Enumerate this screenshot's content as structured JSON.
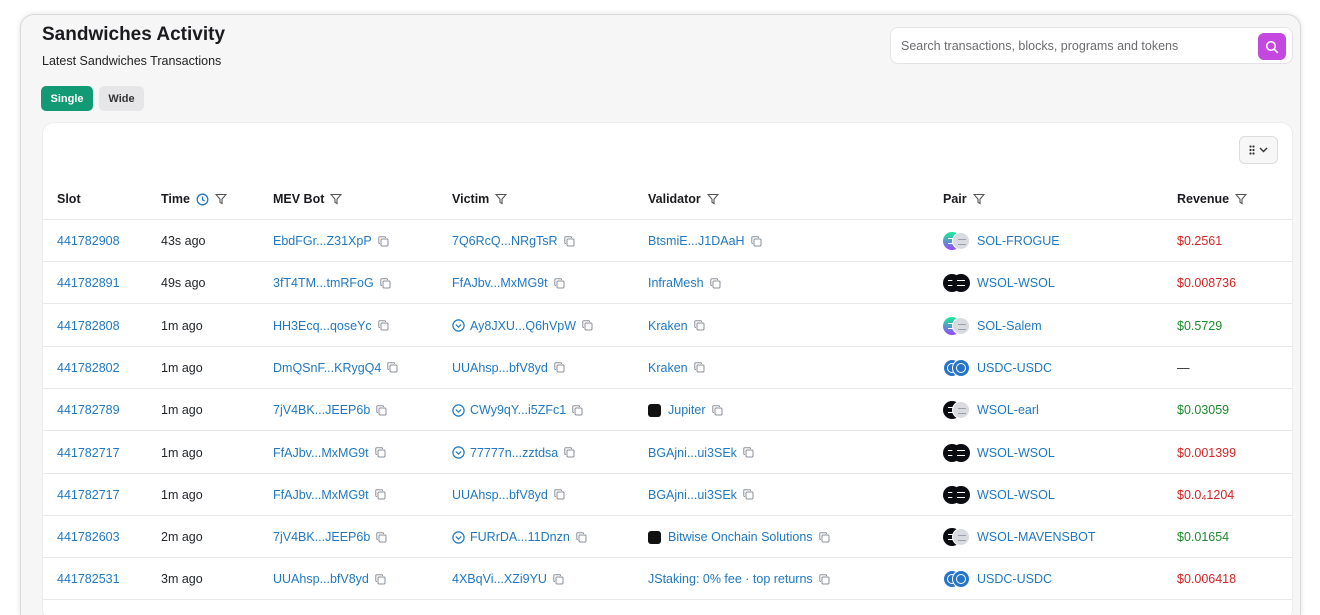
{
  "header": {
    "title": "Sandwiches Activity",
    "subtitle": "Latest Sandwiches Transactions"
  },
  "search": {
    "placeholder": "Search transactions, blocks, programs and tokens",
    "value": ""
  },
  "modes": {
    "single_label": "Single",
    "wide_label": "Wide",
    "selected": "Single"
  },
  "colors": {
    "accent_green": "#119a74",
    "search_button": "#c447e0",
    "link": "#1f78c1",
    "revenue_negative": "#d32525",
    "revenue_positive": "#1c8a2c"
  },
  "table": {
    "columns": {
      "slot": "Slot",
      "time": "Time",
      "mev_bot": "MEV Bot",
      "victim": "Victim",
      "validator": "Validator",
      "pair": "Pair",
      "revenue": "Revenue"
    },
    "rows": [
      {
        "slot": "441782908",
        "time": "43s ago",
        "mev_bot": "EbdFGr...Z31XpP",
        "victim": "7Q6RcQ...NRgTsR",
        "victim_verified": false,
        "validator": "BtsmiE...J1DAaH",
        "validator_logo": false,
        "pair": "SOL-FROGUE",
        "pair_tokens": [
          "sol",
          "grey"
        ],
        "revenue": "$0.2561",
        "revenue_color": "red"
      },
      {
        "slot": "441782891",
        "time": "49s ago",
        "mev_bot": "3fT4TM...tmRFoG",
        "victim": "FfAJbv...MxMG9t",
        "victim_verified": false,
        "validator": "InfraMesh",
        "validator_logo": false,
        "pair": "WSOL-WSOL",
        "pair_tokens": [
          "dark",
          "dark"
        ],
        "revenue": "$0.008736",
        "revenue_color": "red"
      },
      {
        "slot": "441782808",
        "time": "1m ago",
        "mev_bot": "HH3Ecq...qoseYc",
        "victim": "Ay8JXU...Q6hVpW",
        "victim_verified": true,
        "validator": "Kraken",
        "validator_logo": false,
        "pair": "SOL-Salem",
        "pair_tokens": [
          "sol",
          "grey"
        ],
        "revenue": "$0.5729",
        "revenue_color": "green"
      },
      {
        "slot": "441782802",
        "time": "1m ago",
        "mev_bot": "DmQSnF...KRygQ4",
        "victim": "UUAhsp...bfV8yd",
        "victim_verified": false,
        "validator": "Kraken",
        "validator_logo": false,
        "pair": "USDC-USDC",
        "pair_tokens": [
          "usdc",
          "usdc"
        ],
        "revenue": "—",
        "revenue_color": "plain"
      },
      {
        "slot": "441782789",
        "time": "1m ago",
        "mev_bot": "7jV4BK...JEEP6b",
        "victim": "CWy9qY...i5ZFc1",
        "victim_verified": true,
        "validator": "Jupiter",
        "validator_logo": true,
        "pair": "WSOL-earl",
        "pair_tokens": [
          "dark",
          "grey"
        ],
        "revenue": "$0.03059",
        "revenue_color": "green"
      },
      {
        "slot": "441782717",
        "time": "1m ago",
        "mev_bot": "FfAJbv...MxMG9t",
        "victim": "77777n...zztdsa",
        "victim_verified": true,
        "validator": "BGAjni...ui3SEk",
        "validator_logo": false,
        "pair": "WSOL-WSOL",
        "pair_tokens": [
          "dark",
          "dark"
        ],
        "revenue": "$0.001399",
        "revenue_color": "red"
      },
      {
        "slot": "441782717",
        "time": "1m ago",
        "mev_bot": "FfAJbv...MxMG9t",
        "victim": "UUAhsp...bfV8yd",
        "victim_verified": false,
        "validator": "BGAjni...ui3SEk",
        "validator_logo": false,
        "pair": "WSOL-WSOL",
        "pair_tokens": [
          "dark",
          "dark"
        ],
        "revenue": "$0.0₄1204",
        "revenue_color": "red"
      },
      {
        "slot": "441782603",
        "time": "2m ago",
        "mev_bot": "7jV4BK...JEEP6b",
        "victim": "FURrDA...11Dnzn",
        "victim_verified": true,
        "validator": "Bitwise Onchain Solutions",
        "validator_logo": true,
        "pair": "WSOL-MAVENSBOT",
        "pair_tokens": [
          "dark",
          "grey"
        ],
        "revenue": "$0.01654",
        "revenue_color": "green"
      },
      {
        "slot": "441782531",
        "time": "3m ago",
        "mev_bot": "UUAhsp...bfV8yd",
        "victim": "4XBqVi...XZi9YU",
        "victim_verified": false,
        "validator": "JStaking: 0% fee · top returns",
        "validator_logo": false,
        "pair": "USDC-USDC",
        "pair_tokens": [
          "usdc",
          "usdc"
        ],
        "revenue": "$0.006418",
        "revenue_color": "red"
      }
    ]
  }
}
